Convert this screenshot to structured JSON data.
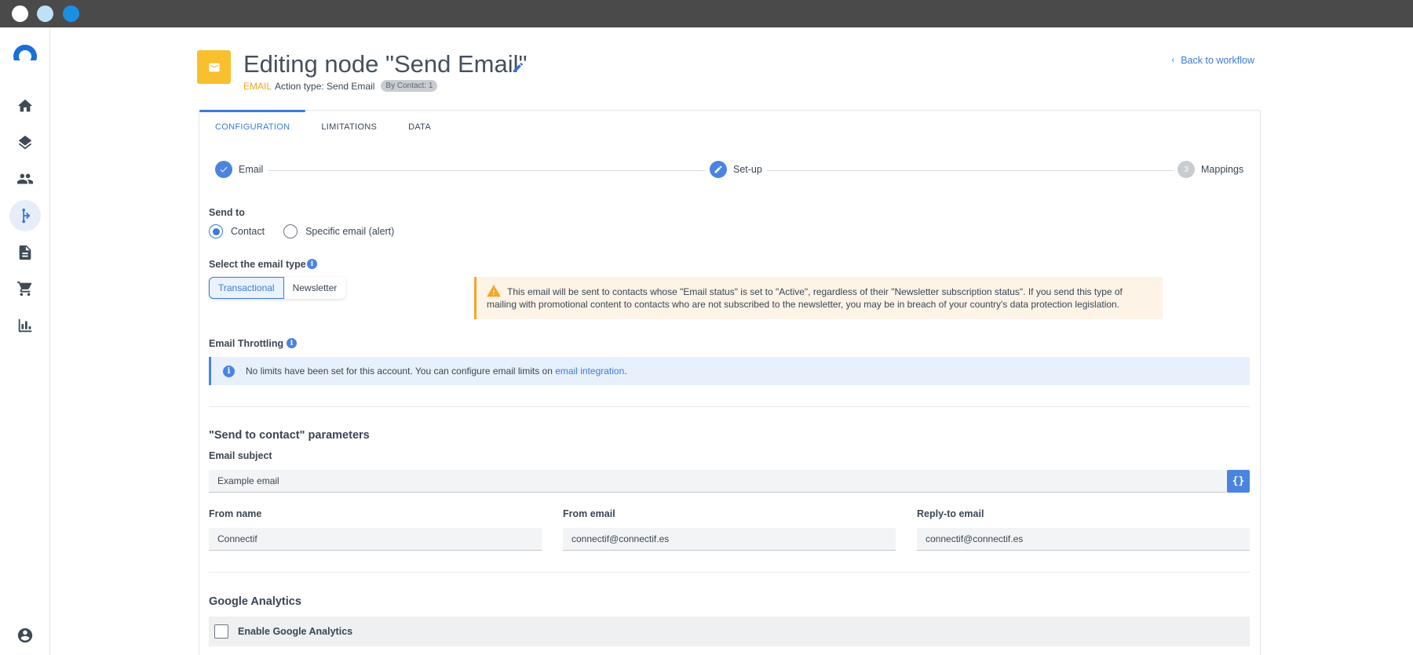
{
  "sidebar": {
    "items": [
      {
        "icon": "home-icon"
      },
      {
        "icon": "layers-icon"
      },
      {
        "icon": "people-icon"
      },
      {
        "icon": "workflow-icon",
        "active": true
      },
      {
        "icon": "document-icon"
      },
      {
        "icon": "cart-icon"
      },
      {
        "icon": "chart-icon"
      }
    ],
    "bottom_icon": "account-icon"
  },
  "header": {
    "title": "Editing node \"Send Email\"",
    "type_tag": "EMAIL",
    "action_type": "Action type: Send Email",
    "badge": "By Contact: 1",
    "back_label": "Back to workflow"
  },
  "tabs": [
    {
      "label": "CONFIGURATION",
      "active": true
    },
    {
      "label": "LIMITATIONS",
      "active": false
    },
    {
      "label": "DATA",
      "active": false
    }
  ],
  "stepper": {
    "steps": [
      {
        "label": "Email",
        "state": "done"
      },
      {
        "label": "Set-up",
        "state": "current"
      },
      {
        "label": "Mappings",
        "state": "todo",
        "number": "3"
      }
    ]
  },
  "send_to": {
    "label": "Send to",
    "options": [
      {
        "label": "Contact",
        "checked": true
      },
      {
        "label": "Specific email (alert)",
        "checked": false
      }
    ]
  },
  "email_type": {
    "label": "Select the email type",
    "options": [
      {
        "label": "Transactional",
        "selected": true
      },
      {
        "label": "Newsletter",
        "selected": false
      }
    ],
    "warning": "This email will be sent to contacts whose \"Email status\" is set to \"Active\", regardless of their \"Newsletter subscription status\". If you send this type of mailing with promotional content to contacts who are not subscribed to the newsletter, you may be in breach of your country's data protection legislation."
  },
  "throttling": {
    "label": "Email Throttling",
    "info_text": "No limits have been set for this account. You can configure email limits on",
    "info_link": "email integration",
    "info_end": "."
  },
  "params": {
    "title": "\"Send to contact\" parameters",
    "subject_label": "Email subject",
    "subject_value": "Example email",
    "var_button": "{}",
    "from_name_label": "From name",
    "from_name_value": "Connectif",
    "from_email_label": "From email",
    "from_email_value": "connectif@connectif.es",
    "reply_to_label": "Reply-to email",
    "reply_to_value": "connectif@connectif.es"
  },
  "analytics": {
    "title": "Google Analytics",
    "checkbox_label": "Enable Google Analytics",
    "checked": false
  },
  "colors": {
    "accent": "#3b7ad8",
    "node_icon": "#f8bf2e",
    "warning": "#f5a623"
  }
}
